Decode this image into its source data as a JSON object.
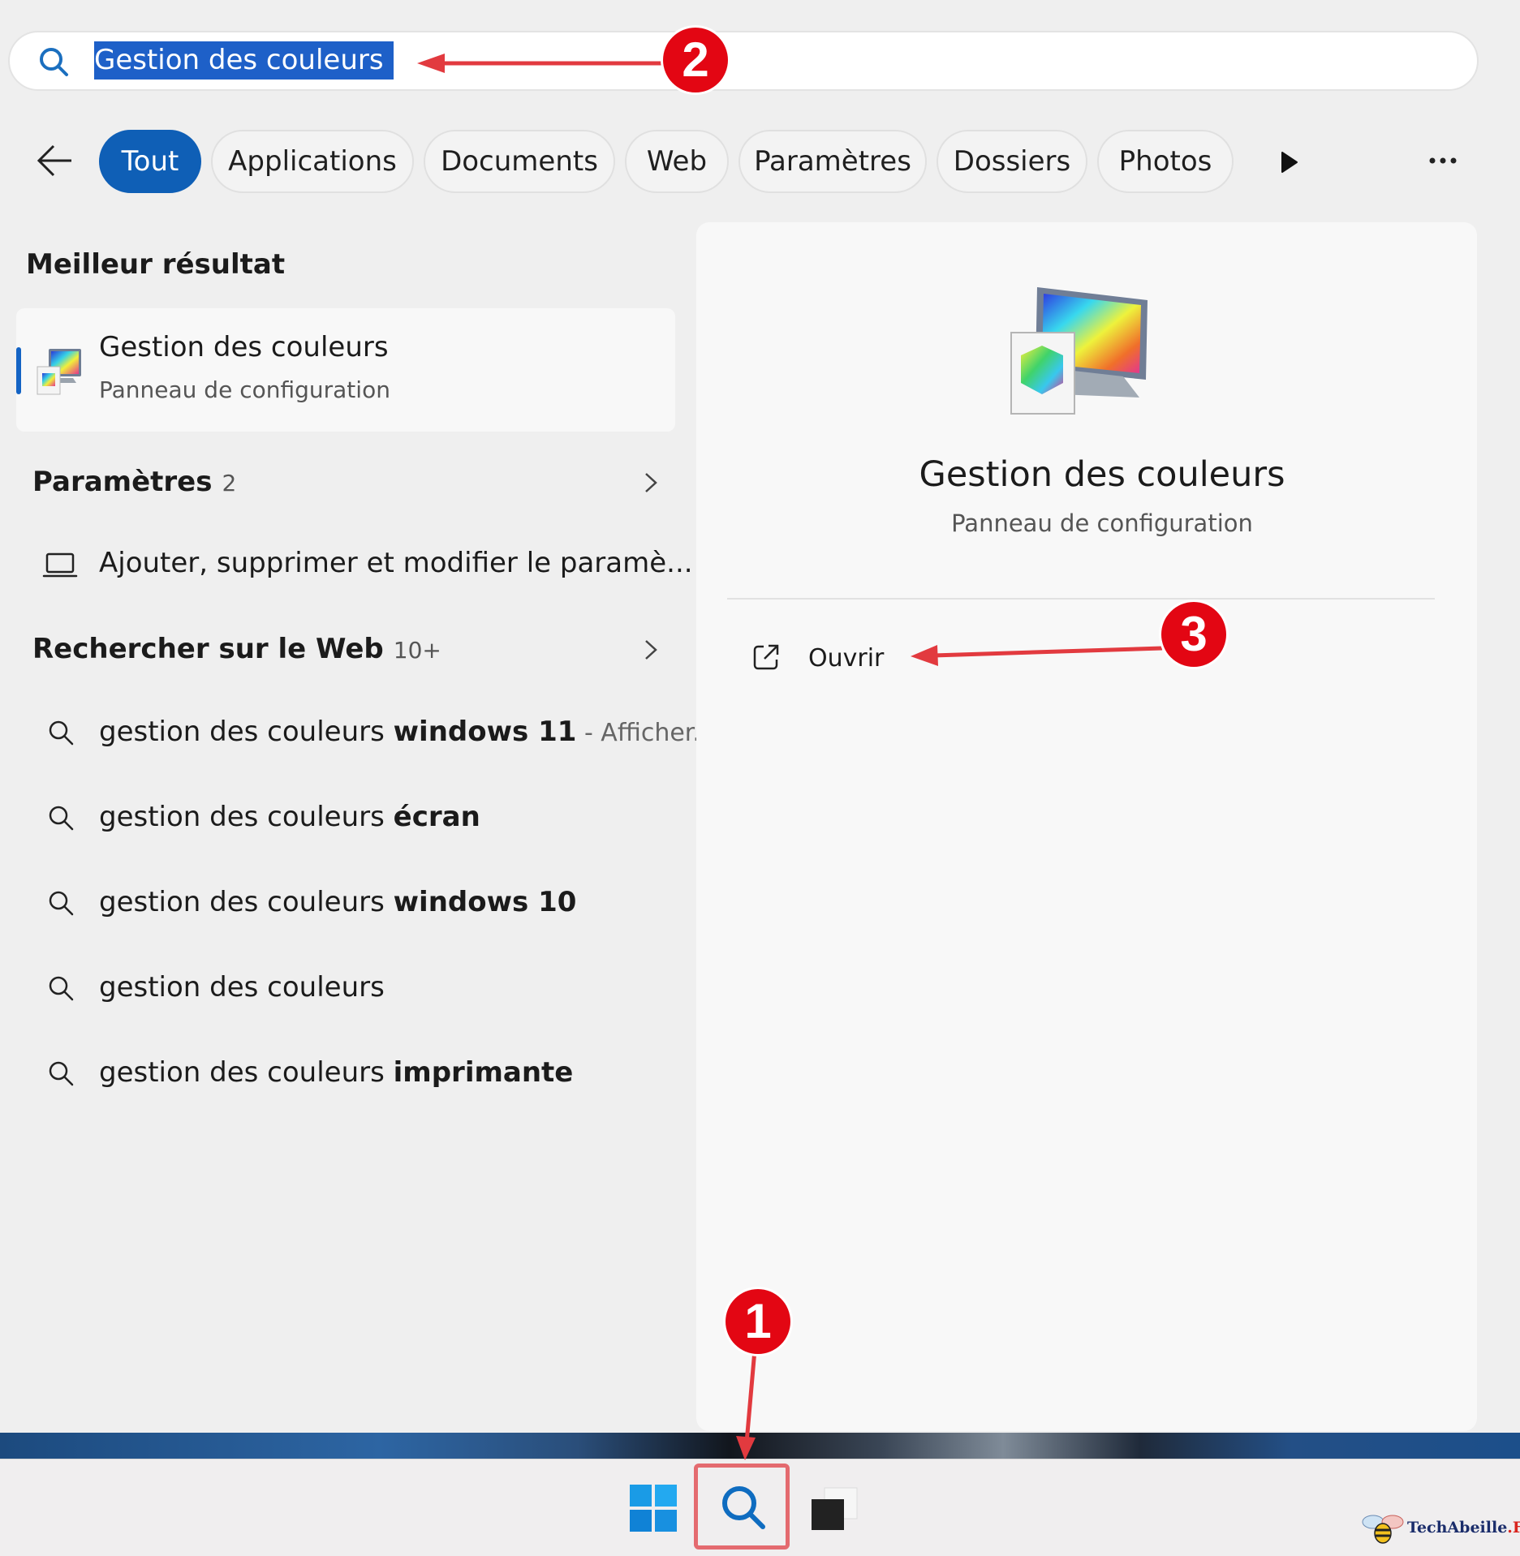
{
  "search": {
    "query": "Gestion des couleurs"
  },
  "filters": {
    "tabs": [
      {
        "label": "Tout",
        "active": true
      },
      {
        "label": "Applications"
      },
      {
        "label": "Documents"
      },
      {
        "label": "Web"
      },
      {
        "label": "Paramètres"
      },
      {
        "label": "Dossiers"
      },
      {
        "label": "Photos"
      }
    ],
    "icons": [
      "back-arrow-icon",
      "play-icon",
      "more-icon"
    ]
  },
  "left": {
    "best_heading": "Meilleur résultat",
    "best": {
      "title": "Gestion des couleurs",
      "subtitle": "Panneau de configuration",
      "icon": "color-management-icon"
    },
    "settings_heading": "Paramètres",
    "settings_count": "2",
    "settings_items": [
      {
        "label": "Ajouter, supprimer et modifier le paramè...",
        "icon": "laptop-icon"
      }
    ],
    "web_heading": "Rechercher sur le Web",
    "web_count": "10+",
    "web_items": [
      {
        "prefix": "gestion des couleurs ",
        "bold": "windows 11",
        "suffix": " - Afficher..."
      },
      {
        "prefix": "gestion des couleurs ",
        "bold": "écran",
        "suffix": ""
      },
      {
        "prefix": "gestion des couleurs ",
        "bold": "windows 10",
        "suffix": ""
      },
      {
        "prefix": "gestion des couleurs",
        "bold": "",
        "suffix": ""
      },
      {
        "prefix": "gestion des couleurs ",
        "bold": "imprimante",
        "suffix": ""
      }
    ]
  },
  "detail": {
    "title": "Gestion des couleurs",
    "subtitle": "Panneau de configuration",
    "actions": [
      {
        "label": "Ouvrir",
        "icon": "open-external-icon"
      }
    ]
  },
  "annotations": {
    "badge1": "1",
    "badge2": "2",
    "badge3": "3",
    "color": "#e30613"
  },
  "taskbar": {
    "icons": [
      "windows-start-icon",
      "search-icon",
      "task-view-icon"
    ]
  },
  "watermark": {
    "brand": "TechAbeille",
    "tld": ".FR"
  },
  "colors": {
    "accent": "#0f5fb6",
    "annotation_red": "#e30613"
  }
}
